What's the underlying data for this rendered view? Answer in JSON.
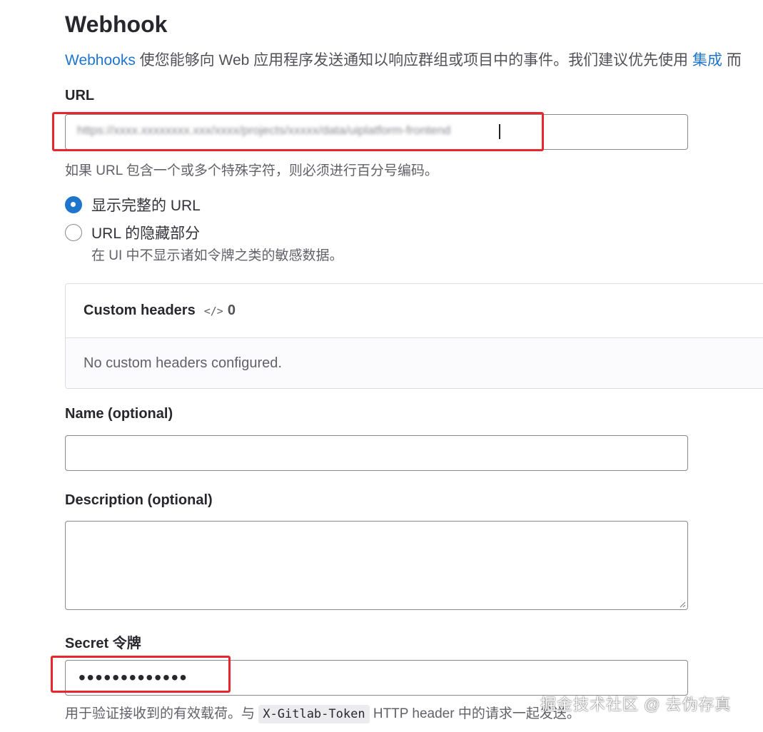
{
  "page": {
    "title": "Webhook",
    "intro_link": "Webhooks",
    "intro_text": " 使您能够向 Web 应用程序发送通知以响应群组或项目中的事件。我们建议优先使用 ",
    "intro_link2": "集成",
    "intro_tail": " 而"
  },
  "url_field": {
    "label": "URL",
    "value": "https://xxxx.xxxxxxxx.xxx/xxxx/projects/xxxxx/data/uiplatform-frontend",
    "help": "如果 URL 包含一个或多个特殊字符，则必须进行百分号编码。"
  },
  "url_mask": {
    "options": [
      {
        "label": "显示完整的 URL",
        "selected": true
      },
      {
        "label": "URL 的隐藏部分",
        "selected": false,
        "help": "在 UI 中不显示诸如令牌之类的敏感数据。"
      }
    ]
  },
  "custom_headers": {
    "title": "Custom headers",
    "icon": "code-icon",
    "count": "0",
    "empty_text": "No custom headers configured."
  },
  "name_field": {
    "label": "Name (optional)",
    "value": ""
  },
  "description_field": {
    "label": "Description (optional)",
    "value": ""
  },
  "secret_field": {
    "label": "Secret 令牌",
    "masked_value": "•••••••••••••",
    "help_prefix": "用于验证接收到的有效载荷。与 ",
    "help_code": "X-Gitlab-Token",
    "help_suffix": " HTTP header 中的请求一起发送。"
  },
  "watermark": "掘金技术社区 @ 去伪存真",
  "colors": {
    "link": "#1f75cb",
    "highlight": "#e8262d",
    "radio_selected": "#1f75cb"
  }
}
